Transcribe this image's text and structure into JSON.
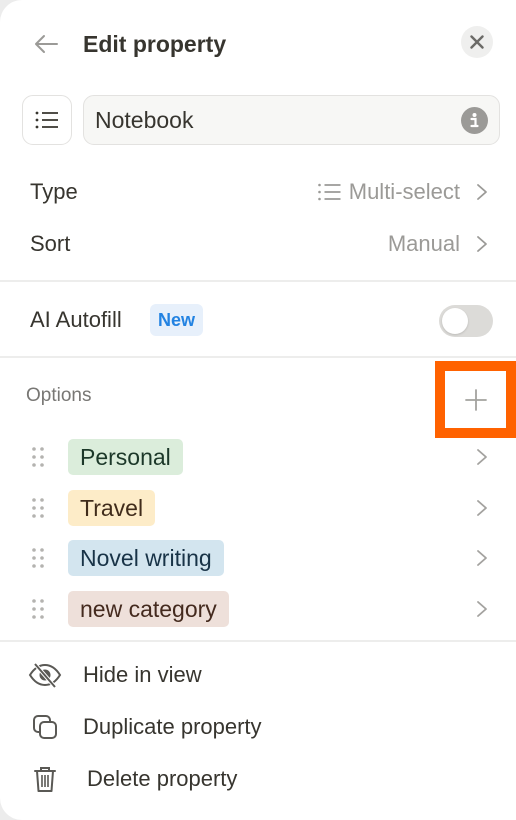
{
  "header": {
    "title": "Edit property",
    "back_icon": "arrow-left-icon",
    "close_icon": "close-icon"
  },
  "name_field": {
    "property_icon": "list-icon",
    "value": "Notebook",
    "info_icon": "info-icon"
  },
  "type_row": {
    "label": "Type",
    "value": "Multi-select",
    "value_icon": "list-icon"
  },
  "sort_row": {
    "label": "Sort",
    "value": "Manual"
  },
  "ai_autofill": {
    "label": "AI Autofill",
    "badge": "New",
    "enabled": false
  },
  "options": {
    "label": "Options",
    "add_icon": "plus-icon",
    "highlight_color": "#ff6200",
    "items": [
      {
        "label": "Personal",
        "bg": "#dbeddb",
        "fg": "#1c3829"
      },
      {
        "label": "Travel",
        "bg": "#fdecc8",
        "fg": "#402c1b"
      },
      {
        "label": "Novel writing",
        "bg": "#d3e5ef",
        "fg": "#183347"
      },
      {
        "label": "new category",
        "bg": "#eee0da",
        "fg": "#442a1e"
      }
    ]
  },
  "actions": [
    {
      "label": "Hide in view",
      "icon": "eye-off-icon"
    },
    {
      "label": "Duplicate property",
      "icon": "duplicate-icon"
    },
    {
      "label": "Delete property",
      "icon": "trash-icon"
    }
  ],
  "colors": {
    "text": "#37352f",
    "muted": "#9b9a97",
    "accent_blue": "#2383e2"
  }
}
